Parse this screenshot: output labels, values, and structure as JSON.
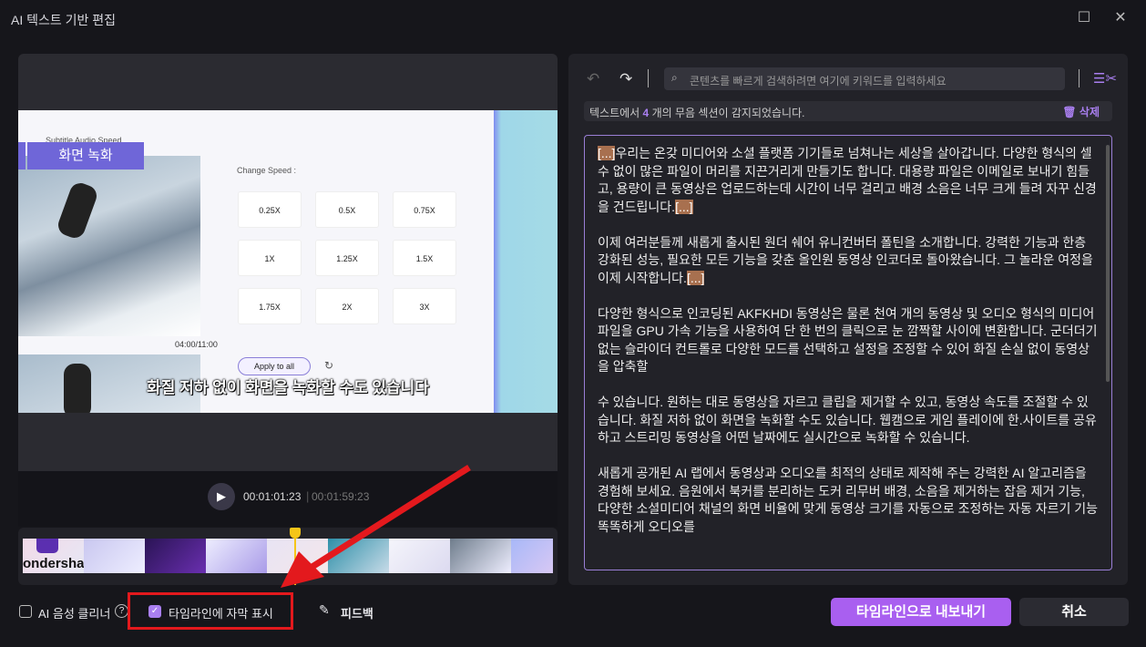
{
  "window": {
    "title": "AI 텍스트 기반 편집",
    "maximize_icon": "square-icon",
    "close_icon": "x-icon"
  },
  "video": {
    "tabs": "Subtitle   Audio   Speed",
    "tag": "화면 녹화",
    "time": "04:00/11:00",
    "speed_label": "Change Speed :",
    "speeds": [
      "0.25X",
      "0.5X",
      "0.75X",
      "1X",
      "1.25X",
      "1.5X",
      "1.75X",
      "2X",
      "3X"
    ],
    "apply": "Apply to all",
    "subtitle": "화질 저하 없이 화면을 녹화할 수도 있습니다"
  },
  "player": {
    "current": "00:01:01:23",
    "total": "00:01:59:23"
  },
  "timeline": {
    "first_thumb_text": "ondersha",
    "playhead_color": "#f5c518"
  },
  "editor": {
    "search_placeholder": "콘텐츠를 빠르게 검색하려면 여기에 키워드를 입력하세요",
    "notice_prefix": "텍스트에서",
    "silence_count": "4",
    "notice_suffix": "개의 무음 섹션이 감지되었습니다.",
    "delete": "삭제",
    "marker": "[...]",
    "paragraphs": [
      {
        "before": true,
        "text": "우리는 온갖 미디어와 소셜 플랫폼 기기들로 넘쳐나는 세상을 살아갑니다. 다양한 형식의 셀 수 없이 많은 파일이 머리를 지끈거리게 만들기도 합니다. 대용량 파일은 이메일로 보내기 힘들고, 용량이 큰 동영상은 업로드하는데 시간이 너무 걸리고 배경 소음은 너무 크게 들려 자꾸 신경을 건드립니다.",
        "after": true
      },
      {
        "before": false,
        "text": "이제 여러분들께 새롭게 출시된 원더 쉐어 유니컨버터 폴틴을 소개합니다. 강력한 기능과 한층 강화된 성능, 필요한 모든 기능을 갖춘 올인원 동영상 인코더로 돌아왔습니다. 그 놀라운 여정을 이제 시작합니다.",
        "after": true
      },
      {
        "before": false,
        "text": "다양한 형식으로 인코딩된 AKFKHDI 동영상은 물론 천여 개의 동영상 및 오디오 형식의 미디어 파일을 GPU 가속 기능을 사용하여 단 한 번의 클릭으로 눈 깜짝할 사이에 변환합니다. 군더더기 없는 슬라이더 컨트롤로 다양한 모드를 선택하고 설정을 조정할 수 있어 화질 손실 없이 동영상을 압축할",
        "after": false
      },
      {
        "before": false,
        "text": " 수 있습니다. 원하는 대로 동영상을 자르고 클립을 제거할 수 있고, 동영상 속도를 조절할 수 있습니다. 화질 저하 없이 화면을 녹화할 수도 있습니다. 웹캠으로 게임 플레이에 한.사이트를 공유하고 스트리밍 동영상을 어떤 날짜에도 실시간으로 녹화할 수 있습니다.",
        "after": false
      },
      {
        "before": false,
        "text": " 새롭게 공개된 AI 랩에서 동영상과 오디오를 최적의 상태로 제작해 주는 강력한 AI 알고리즘을 경험해 보세요. 음원에서 북커를 분리하는 도커 리무버 배경, 소음을 제거하는 잡음 제거 기능, 다양한 소셜미디어 채널의 화면 비율에 맞게 동영상 크기를 자동으로 조정하는 자동 자르기 기능 똑똑하게 오디오를",
        "after": false
      }
    ]
  },
  "footer": {
    "ai_voice_cleaner": "AI 음성 클리너",
    "ai_voice_checked": false,
    "show_subtitles": "타임라인에 자막 표시",
    "show_subtitles_checked": true,
    "feedback": "피드백",
    "export": "타임라인으로 내보내기",
    "cancel": "취소"
  },
  "colors": {
    "accent": "#a95ff0",
    "silence_marker": "#a8704f",
    "annotation": "#e3191d"
  }
}
